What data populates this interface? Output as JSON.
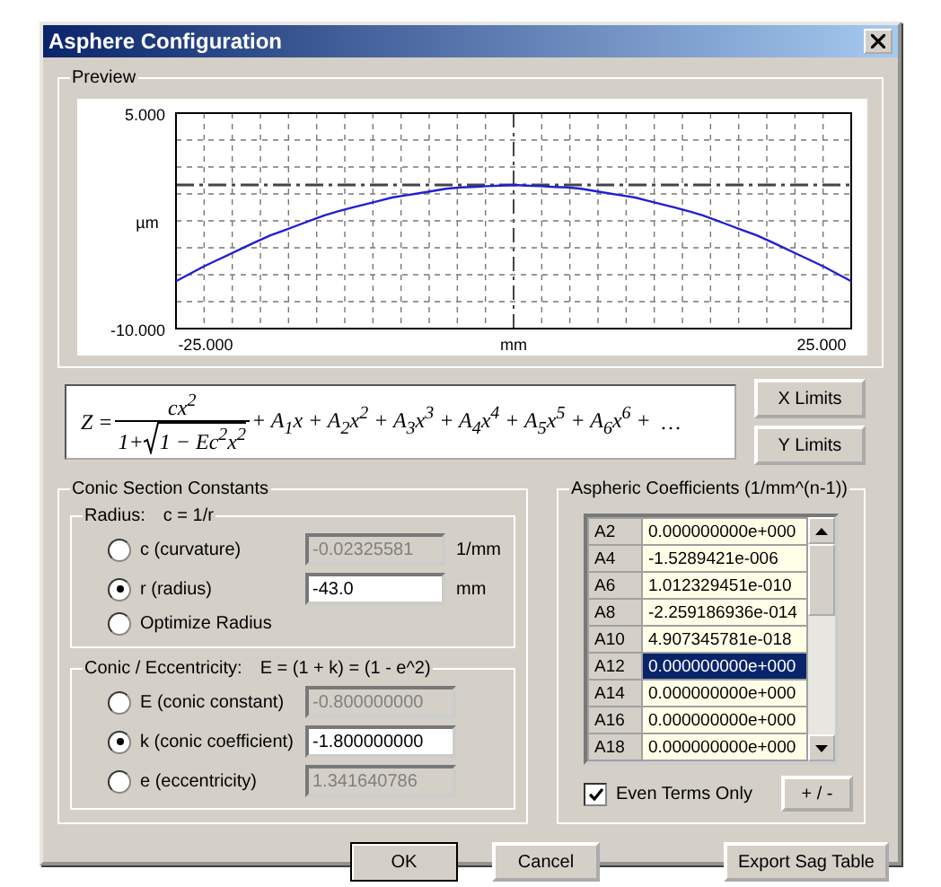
{
  "window": {
    "title": "Asphere Configuration"
  },
  "preview": {
    "title": "Preview",
    "chart_data": {
      "type": "line",
      "xlabel": "mm",
      "ylabel": "µm",
      "x": [
        -27.4,
        -25,
        -20,
        -15,
        -10,
        -5,
        0,
        5,
        10,
        15,
        20,
        25,
        27.4
      ],
      "series": [
        {
          "color": "#2020d0",
          "values": [
            -6.7,
            -5.6,
            -3.6,
            -2.0,
            -0.9,
            -0.2,
            0,
            -0.2,
            -0.9,
            -2.0,
            -3.6,
            -5.6,
            -6.7
          ]
        }
      ],
      "ref_lines": [
        {
          "axis": "x",
          "value": 0
        },
        {
          "axis": "y",
          "value": 0
        }
      ],
      "xlim": [
        -27.4,
        27.4
      ],
      "ylim": [
        -10,
        5
      ],
      "xticks": [
        {
          "value": -25,
          "label": "-25.000"
        },
        {
          "value": 25,
          "label": "25.000"
        }
      ],
      "yticks": [
        {
          "value": 5,
          "label": "5.000"
        },
        {
          "value": -10,
          "label": "-10.000"
        }
      ]
    }
  },
  "formula": {
    "lhs": "Z =",
    "numerator": "cx$^{2}$",
    "denominator_prefix": "1+",
    "radicand": "1 − Ec$^{2}$x$^{2}$",
    "terms": "+ A$_{1}$x  + A$_{2}$x$^{2}$ + A$_{3}$x$^{3}$ + A$_{4}$x$^{4}$ + A$_{5}$x$^{5}$ + A$_{6}$x$^{6}$ +",
    "ellipsis": "…"
  },
  "limit_buttons": [
    "X Limits",
    "Y Limits"
  ],
  "conic_section": {
    "title": "Conic Section Constants",
    "radius": {
      "title": "Radius:",
      "relation": "c = 1/r",
      "options": [
        {
          "label": "c (curvature)",
          "selected": false,
          "value": "-0.02325581",
          "disabled": true,
          "unit": "1/mm"
        },
        {
          "label": "r (radius)",
          "selected": true,
          "value": "-43.0",
          "disabled": false,
          "unit": "mm"
        },
        {
          "label": "Optimize Radius",
          "selected": false
        }
      ]
    },
    "conic": {
      "title": "Conic / Eccentricity:",
      "relation": "E  =  (1 + k)  =  (1 - e^2)",
      "options": [
        {
          "label": "E (conic constant)",
          "selected": false,
          "value": "-0.800000000",
          "disabled": true
        },
        {
          "label": "k (conic coefficient)",
          "selected": true,
          "value": "-1.800000000",
          "disabled": false
        },
        {
          "label": "e (eccentricity)",
          "selected": false,
          "value": "1.341640786",
          "disabled": true
        }
      ]
    }
  },
  "aspheric": {
    "title": "Aspheric Coefficients (1/mm^(n-1))",
    "rows": [
      {
        "name": "A2",
        "value": "0.000000000e+000",
        "selected": false
      },
      {
        "name": "A4",
        "value": "-1.5289421e-006",
        "selected": false
      },
      {
        "name": "A6",
        "value": "1.012329451e-010",
        "selected": false
      },
      {
        "name": "A8",
        "value": "-2.259186936e-014",
        "selected": false
      },
      {
        "name": "A10",
        "value": "4.907345781e-018",
        "selected": false
      },
      {
        "name": "A12",
        "value": "0.000000000e+000",
        "selected": true
      },
      {
        "name": "A14",
        "value": "0.000000000e+000",
        "selected": false
      },
      {
        "name": "A16",
        "value": "0.000000000e+000",
        "selected": false
      },
      {
        "name": "A18",
        "value": "0.000000000e+000",
        "selected": false
      }
    ],
    "even_terms": {
      "label": "Even Terms Only",
      "checked": true
    },
    "toggle_button": "+ / -"
  },
  "buttons": {
    "ok": "OK",
    "cancel": "Cancel",
    "export": "Export Sag Table"
  }
}
